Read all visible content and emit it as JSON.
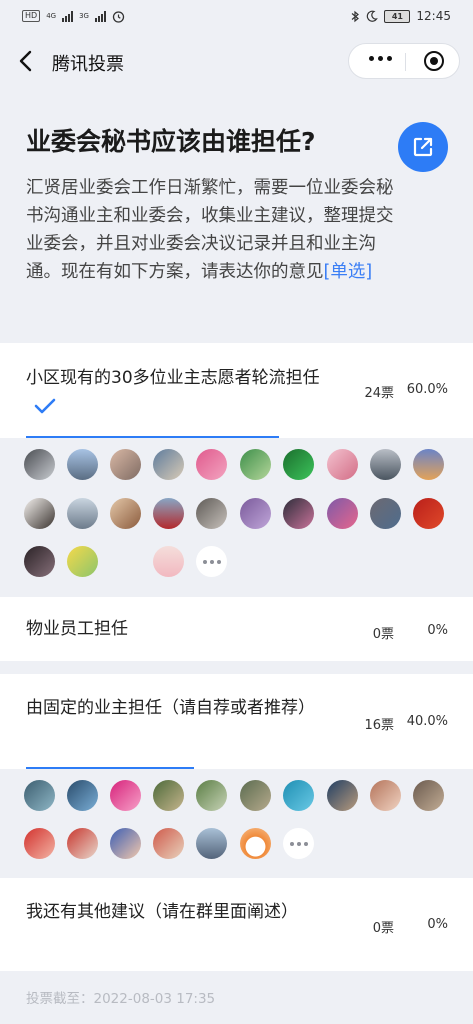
{
  "status_bar": {
    "left_chip": "HD",
    "network1": "4G",
    "network2": "3G",
    "battery": "41",
    "time": "12:45"
  },
  "nav": {
    "title": "腾讯投票"
  },
  "poll": {
    "title": "业委会秘书应该由谁担任?",
    "description": "汇贤居业委会工作日渐繁忙，需要一位业委会秘书沟通业主和业委会，收集业主建议，整理提交业委会，并且对业委会决议记录并且和业主沟通。现在有如下方案，请表达你的意见",
    "type_tag": "[单选]",
    "options": [
      {
        "text": "小区现有的30多位业主志愿者轮流担任",
        "votes": "24票",
        "percent": "60.0%",
        "progress": 0.6,
        "selected": true
      },
      {
        "text": "物业员工担任",
        "votes": "0票",
        "percent": "0%",
        "progress": 0,
        "selected": false
      },
      {
        "text": "由固定的业主担任（请自荐或者推荐）",
        "votes": "16票",
        "percent": "40.0%",
        "progress": 0.4,
        "selected": false
      },
      {
        "text": "我还有其他建议（请在群里面阐述）",
        "votes": "0票",
        "percent": "0%",
        "progress": 0,
        "selected": false
      }
    ],
    "deadline": "投票截至：2022-08-03 17:35"
  },
  "colors": {
    "accent": "#2d7cf6",
    "background": "#eef0f5"
  }
}
